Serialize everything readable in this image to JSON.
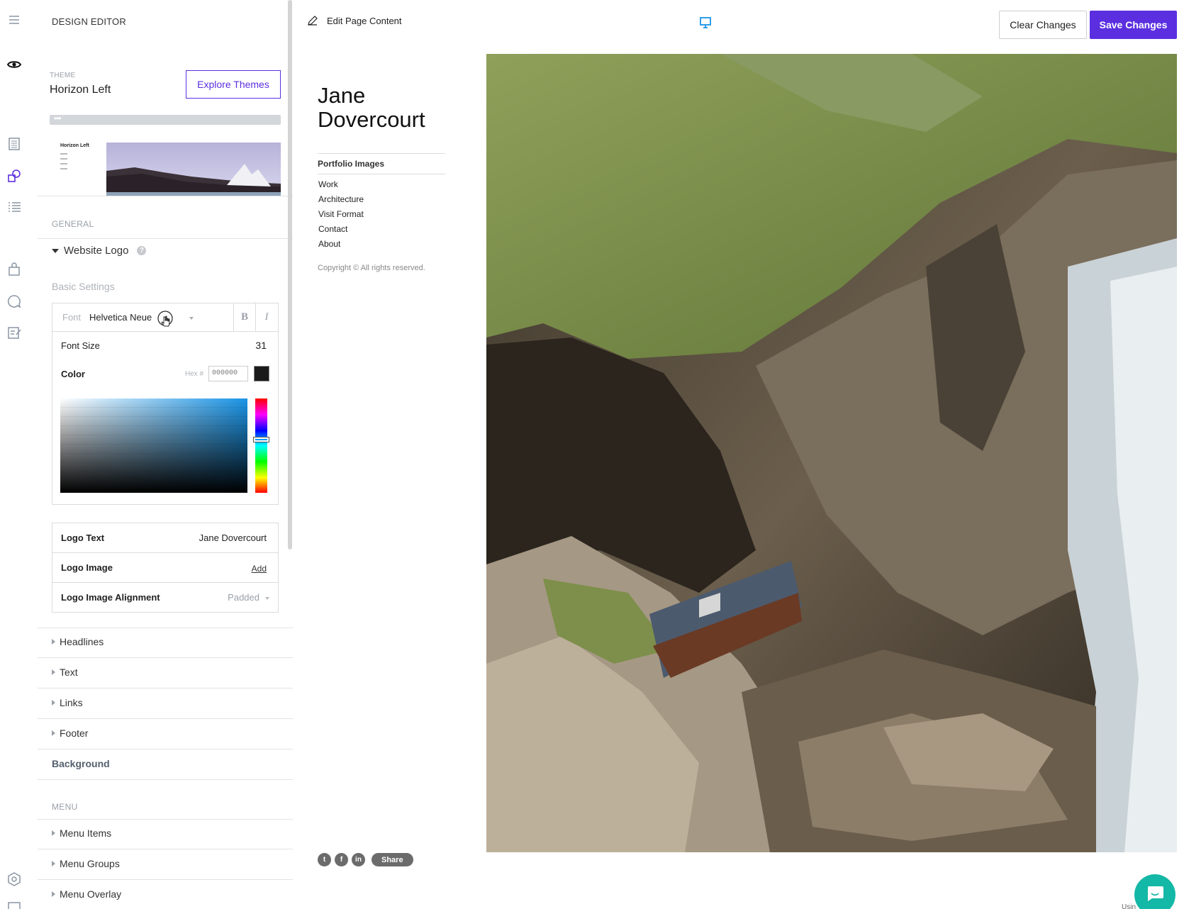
{
  "editor": {
    "title": "DESIGN EDITOR",
    "theme_label": "THEME",
    "theme_name": "Horizon Left",
    "explore_label": "Explore Themes",
    "thumb_title": "Horizon Left",
    "general_label": "GENERAL",
    "website_logo_label": "Website Logo",
    "help_glyph": "?",
    "basic_settings_label": "Basic Settings",
    "font_label": "Font",
    "font_value": "Helvetica Neue",
    "bold_label": "B",
    "italic_label": "I",
    "font_size_label": "Font Size",
    "font_size_value": "31",
    "color_label": "Color",
    "hex_label": "Hex #",
    "hex_value": "000000",
    "swatch_color": "#1a1a1a",
    "logo_text_label": "Logo Text",
    "logo_text_value": "Jane Dovercourt",
    "logo_image_label": "Logo Image",
    "logo_image_action": "Add",
    "logo_align_label": "Logo Image Alignment",
    "logo_align_value": "Padded",
    "sections": [
      {
        "label": "Headlines"
      },
      {
        "label": "Text"
      },
      {
        "label": "Links"
      },
      {
        "label": "Footer"
      }
    ],
    "background_label": "Background",
    "menu_label": "MENU",
    "menu_sections": [
      {
        "label": "Menu Items"
      },
      {
        "label": "Menu Groups"
      },
      {
        "label": "Menu Overlay"
      }
    ]
  },
  "rail_icons": [
    "menu-icon",
    "eye-icon",
    "pages-icon",
    "shapes-icon",
    "list-icon",
    "store-icon",
    "chat-bubble-icon",
    "blog-icon",
    "settings-icon",
    "layout-icon"
  ],
  "toolbar": {
    "edit_content_label": "Edit Page Content",
    "clear_label": "Clear Changes",
    "save_label": "Save Changes",
    "accent_color": "#5b2fe0"
  },
  "site": {
    "logo_text": "Jane Dovercourt",
    "nav_group": "Portfolio Images",
    "nav": [
      "Work",
      "Architecture",
      "Visit Format",
      "Contact",
      "About"
    ],
    "copyright": "Copyright © All rights reserved.",
    "share_label": "Share",
    "social_icons": [
      "twitter-icon",
      "facebook-icon",
      "linkedin-icon"
    ]
  },
  "footer_partial_text": "Usin"
}
